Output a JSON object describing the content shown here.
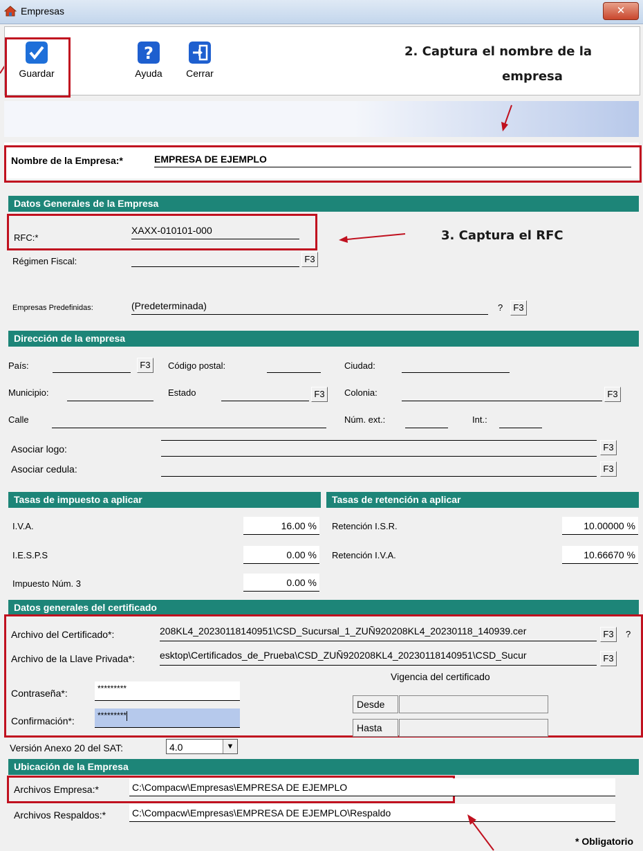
{
  "window": {
    "title": "Empresas",
    "close_glyph": "✕"
  },
  "toolbar": {
    "save_label": "Guardar",
    "help_label": "Ayuda",
    "close_label": "Cerrar"
  },
  "annotations": {
    "step2_line1": "2.   Captura el nombre de la",
    "step2_line2": "empresa",
    "step3": "3.   Captura el RFC"
  },
  "company": {
    "name_label": "Nombre de la Empresa:*",
    "name_value": "EMPRESA DE EJEMPLO"
  },
  "general": {
    "header": "Datos Generales de la Empresa",
    "rfc_label": "RFC:*",
    "rfc_value": "XAXX-010101-000",
    "regimen_label": "Régimen Fiscal:",
    "predef_label": "Empresas Predefinidas:",
    "predef_value": "(Predeterminada)",
    "predef_help": "?",
    "f3": "F3"
  },
  "address": {
    "header": "Dirección de la empresa",
    "pais": "País:",
    "cp": "Código postal:",
    "ciudad": "Ciudad:",
    "municipio": "Municipio:",
    "estado": "Estado",
    "colonia": "Colonia:",
    "calle": "Calle",
    "num_ext": "Núm. ext.:",
    "int": "Int.:",
    "logo": "Asociar logo:",
    "cedula": "Asociar cedula:"
  },
  "taxes": {
    "header": "Tasas de impuesto a aplicar",
    "iva_label": "I.V.A.",
    "iva_value": "16.00 %",
    "iesps_label": "I.E.S.P.S",
    "iesps_value": "0.00 %",
    "imp3_label": "Impuesto Núm. 3",
    "imp3_value": "0.00 %"
  },
  "retentions": {
    "header": "Tasas de retención a aplicar",
    "isr_label": "Retención I.S.R.",
    "isr_value": "10.00000 %",
    "iva_label": "Retención I.V.A.",
    "iva_value": "10.66670 %"
  },
  "certificate": {
    "header": "Datos generales del certificado",
    "cert_label": "Archivo del Certificado*:",
    "cert_value": "208KL4_20230118140951\\CSD_Sucursal_1_ZUÑ920208KL4_20230118_140939.cer",
    "cert_help": "?",
    "key_label": "Archivo de la Llave Privada*:",
    "key_value": "esktop\\Certificados_de_Prueba\\CSD_ZUÑ920208KL4_20230118140951\\CSD_Sucur",
    "password_label": "Contraseña*:",
    "password_value": "*********",
    "confirm_label": "Confirmación*:",
    "confirm_value": "*********",
    "vigencia_title": "Vigencia del certificado",
    "desde_label": "Desde",
    "hasta_label": "Hasta"
  },
  "version": {
    "label": "Versión Anexo 20 del SAT:",
    "value": "4.0",
    "arrow": "▼"
  },
  "location": {
    "header": "Ubicación de la Empresa",
    "archivos_label": "Archivos Empresa:*",
    "archivos_value": "C:\\Compacw\\Empresas\\EMPRESA DE EJEMPLO",
    "respaldos_label": "Archivos Respaldos:*",
    "respaldos_value": "C:\\Compacw\\Empresas\\EMPRESA DE EJEMPLO\\Respaldo"
  },
  "footer": {
    "required_note": "* Obligatorio"
  }
}
